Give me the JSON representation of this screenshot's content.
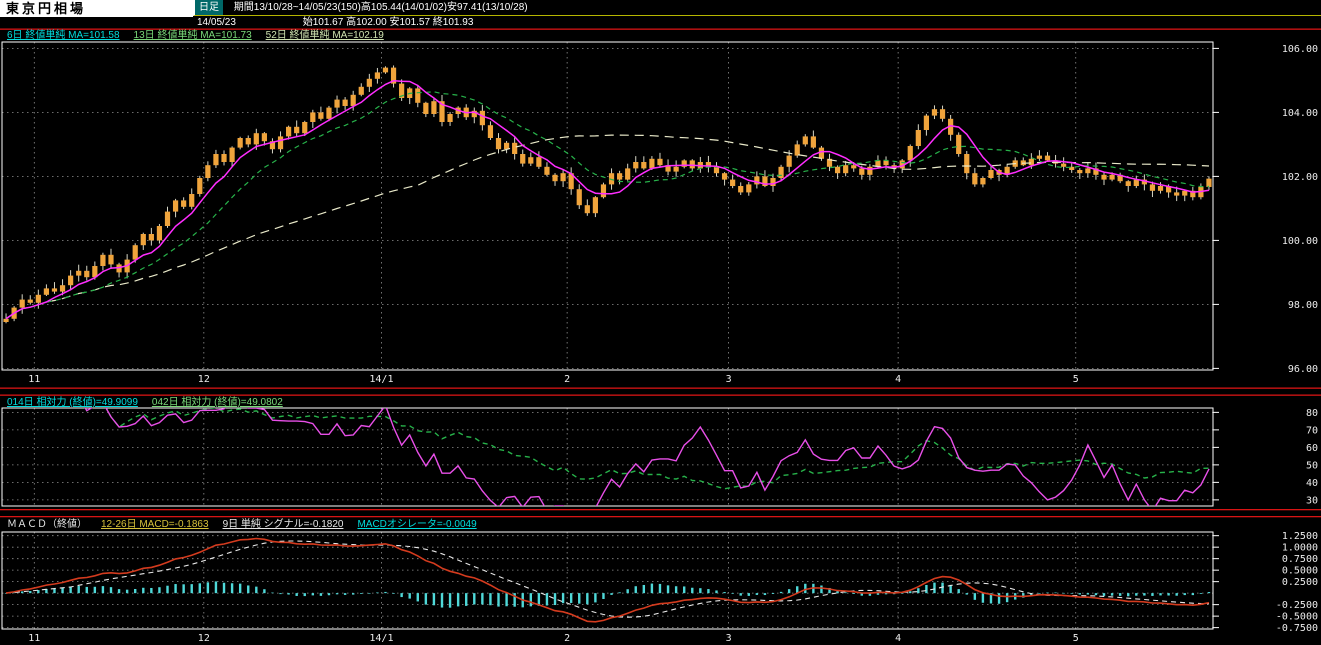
{
  "window": {
    "title": "東京円相場",
    "header": {
      "timeframe": "日足",
      "period_info": "期間13/10/28~14/05/23(150)高105.44(14/01/02)安97.41(13/10/28)",
      "date": "14/05/23",
      "day_ohlc": "始101.67  高102.00  安101.57  終101.93"
    }
  },
  "panels": {
    "main": {
      "legend": [
        {
          "label": "6日 終値単純 MA=101.58",
          "color": "#00dede",
          "underline": true
        },
        {
          "label": "13日 終値単純 MA=101.73",
          "color": "#79d979",
          "underline": true
        },
        {
          "label": "52日 終値単純 MA=102.19",
          "color": "#cfe3b0",
          "underline": true
        }
      ]
    },
    "rsi": {
      "legend": [
        {
          "label": "014日 相対力 (終値)=49.9099",
          "color": "#00dede",
          "underline": true
        },
        {
          "label": "042日 相対力 (終値)=49.0802",
          "color": "#79d979",
          "underline": true
        }
      ]
    },
    "macd": {
      "legend": [
        {
          "label": "ＭＡＣＤ（終値）",
          "color": "#e8e8e8",
          "underline": false
        },
        {
          "label": "12-26日 MACD=-0.1863",
          "color": "#d8c23a",
          "underline": true
        },
        {
          "label": "9日 単純 シグナル=-0.1820",
          "color": "#e8e8e8",
          "underline": true
        },
        {
          "label": "MACDオシレータ=-0.0049",
          "color": "#00dede",
          "underline": true
        }
      ]
    }
  },
  "chart_data": [
    {
      "type": "candlestick",
      "title": "東京円相場 日足",
      "period": "13/10/28~14/05/23 (150 bars)",
      "x_tick_labels": [
        "11",
        "12",
        "14/1",
        "2",
        "3",
        "4",
        "5"
      ],
      "x_tick_indices": [
        4,
        25,
        47,
        70,
        90,
        111,
        133
      ],
      "y_ticks": [
        106,
        104,
        102,
        100,
        98,
        96
      ],
      "y_tick_labels": [
        "106.00",
        "104.00",
        "102.00",
        "100.00",
        "98.00",
        "96.00"
      ],
      "ylim": [
        95.95,
        106.2
      ],
      "bar_color": "#f0a43c",
      "first_open": 97.45,
      "period_high": {
        "value": 105.44,
        "date": "14/01/02"
      },
      "period_low": {
        "value": 97.41,
        "date": "13/10/28"
      },
      "last_bar": {
        "date": "14/05/23",
        "open": 101.67,
        "high": 102.0,
        "low": 101.57,
        "close": 101.93
      },
      "closes": [
        97.55,
        97.9,
        98.15,
        98.05,
        98.3,
        98.5,
        98.4,
        98.6,
        98.9,
        99.05,
        98.85,
        99.2,
        99.55,
        99.25,
        99.0,
        99.4,
        99.85,
        100.2,
        100.0,
        100.45,
        100.9,
        101.25,
        101.05,
        101.45,
        101.95,
        102.35,
        102.7,
        102.45,
        102.9,
        103.2,
        103.0,
        103.35,
        103.1,
        102.85,
        103.25,
        103.55,
        103.35,
        103.7,
        104.0,
        103.8,
        104.15,
        104.4,
        104.2,
        104.55,
        104.8,
        105.05,
        105.25,
        105.4,
        104.9,
        104.45,
        104.75,
        104.3,
        103.95,
        104.35,
        103.7,
        103.95,
        104.15,
        103.85,
        104.05,
        103.6,
        103.2,
        102.85,
        103.05,
        102.7,
        102.4,
        102.6,
        102.3,
        102.05,
        101.85,
        102.1,
        101.6,
        101.1,
        100.85,
        101.35,
        101.75,
        102.1,
        101.9,
        102.25,
        102.45,
        102.25,
        102.55,
        102.35,
        102.15,
        102.3,
        102.5,
        102.25,
        102.45,
        102.3,
        102.1,
        101.9,
        101.7,
        101.5,
        101.75,
        102.0,
        101.7,
        101.95,
        102.3,
        102.65,
        103.0,
        103.25,
        102.9,
        102.55,
        102.3,
        102.1,
        102.35,
        102.25,
        102.05,
        102.3,
        102.5,
        102.35,
        102.25,
        102.5,
        102.95,
        103.45,
        103.9,
        104.1,
        103.8,
        103.3,
        102.7,
        102.1,
        101.75,
        101.95,
        102.2,
        102.05,
        102.3,
        102.5,
        102.35,
        102.55,
        102.65,
        102.5,
        102.4,
        102.3,
        102.2,
        102.1,
        102.25,
        102.05,
        101.9,
        102.05,
        101.85,
        101.7,
        101.9,
        101.75,
        101.55,
        101.7,
        101.5,
        101.4,
        101.55,
        101.35,
        101.67,
        101.93
      ],
      "overlays": [
        {
          "name": "MA6",
          "period": 6,
          "type": "sma",
          "color": "#ff2dff",
          "dash": null,
          "last": 101.58
        },
        {
          "name": "MA13",
          "period": 13,
          "type": "sma",
          "color": "#27b24a",
          "dash": "5,4",
          "last": 101.73
        },
        {
          "name": "MA52",
          "period": 52,
          "type": "sma",
          "color": "#e9e9c9",
          "dash": "9,6",
          "last": 102.19
        }
      ]
    },
    {
      "type": "line",
      "name": "相対力 (RSI)",
      "derived_from": "closes of chart 0",
      "series": [
        {
          "name": "014日 相対力（終値）",
          "period": 14,
          "color": "#e84fe8",
          "dash": null,
          "last": 49.9099
        },
        {
          "name": "042日 相対力（終値）",
          "period": 42,
          "color": "#27b24a",
          "dash": "5,4",
          "last": 49.0802
        }
      ],
      "y_ticks": [
        80,
        70,
        60,
        50,
        40,
        30
      ],
      "ylim": [
        26.5,
        82.5
      ]
    },
    {
      "type": "macd",
      "name": "ＭＡＣＤ（終値）",
      "derived_from": "closes of chart 0",
      "params": {
        "fast": 12,
        "slow": 26,
        "signal": 9
      },
      "series": [
        {
          "name": "ＭＡＣＤ",
          "color": "#d43b1e",
          "dash": null,
          "last": -0.1863
        },
        {
          "name": "シグナル",
          "color": "#e8e8e8",
          "dash": "5,4",
          "last": -0.182
        },
        {
          "name": "ＭＡＣＤオシレータ",
          "color": "#4fd9d9",
          "type": "bar",
          "last": -0.0049
        }
      ],
      "y_ticks": [
        1.25,
        1.0,
        0.75,
        0.5,
        0.25,
        -0.25,
        -0.5,
        -0.75
      ],
      "y_tick_labels": [
        "1.2500",
        "1.0000",
        "0.7500",
        "0.5000",
        "0.2500",
        "-0.2500",
        "-0.5000",
        "-0.7500"
      ],
      "ylim": [
        -0.78,
        1.33
      ]
    }
  ]
}
